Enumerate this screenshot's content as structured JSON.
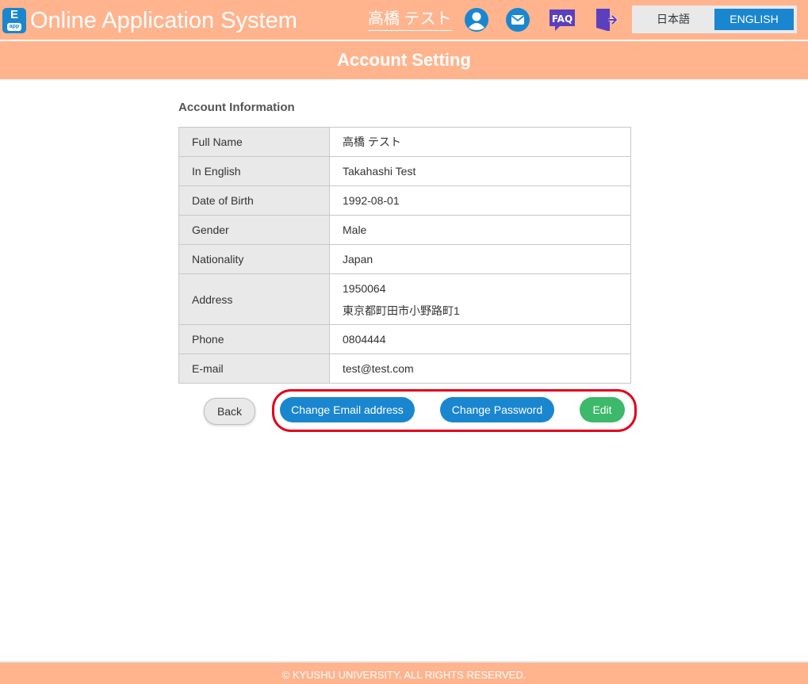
{
  "header": {
    "logo_letter": "E",
    "logo_sub": "app",
    "app_title": "Online Application System",
    "user_name": "高橋 テスト",
    "faq_label": "FAQ",
    "languages": {
      "japanese": "日本語",
      "english": "ENGLISH",
      "selected": "ENGLISH"
    }
  },
  "page": {
    "title": "Account Setting"
  },
  "account": {
    "section_title": "Account Information",
    "rows": [
      {
        "label": "Full Name",
        "value": "高橋 テスト"
      },
      {
        "label": "In English",
        "value": "Takahashi Test"
      },
      {
        "label": "Date of Birth",
        "value": "1992-08-01"
      },
      {
        "label": "Gender",
        "value": "Male"
      },
      {
        "label": "Nationality",
        "value": "Japan"
      },
      {
        "label": "Address",
        "postal": "1950064",
        "value": "東京都町田市小野路町1"
      },
      {
        "label": "Phone",
        "value": "0804444"
      },
      {
        "label": "E-mail",
        "value": "test@test.com"
      }
    ]
  },
  "actions": {
    "back": "Back",
    "change_email": "Change Email address",
    "change_password": "Change Password",
    "edit": "Edit"
  },
  "footer": {
    "copyright": "© KYUSHU UNIVERSITY. ALL RIGHTS RESERVED."
  },
  "colors": {
    "header_bg": "#ffb48e",
    "primary_blue": "#1a86d0",
    "edit_green": "#3cb96a",
    "highlight_red": "#e3001b",
    "faq_purple": "#5a3fbf"
  }
}
